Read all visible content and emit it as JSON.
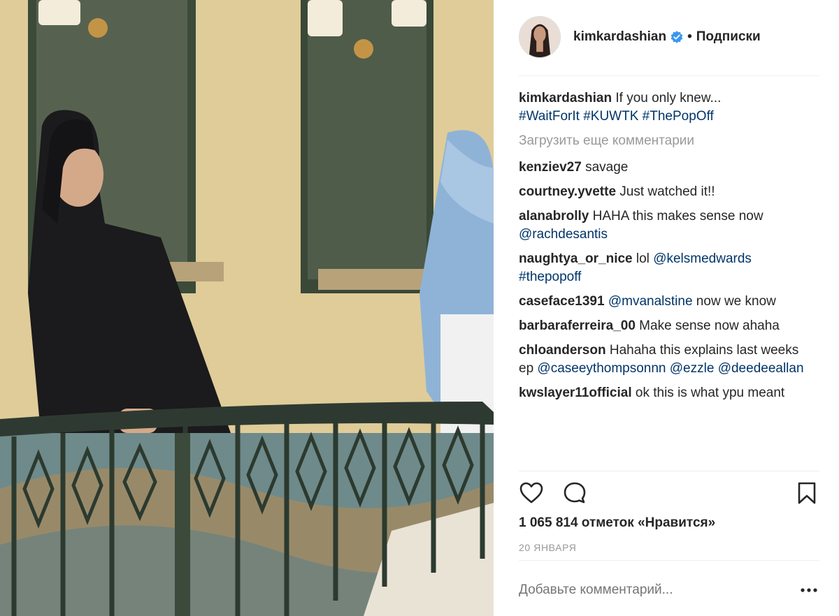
{
  "post": {
    "username": "kimkardashian",
    "separator": "•",
    "follow_label": "Подписки",
    "caption_user": "kimkardashian",
    "caption_text": " If you only knew...",
    "caption_tags": [
      "#WaitForIt",
      "#KUWTK",
      "#ThePopOff"
    ],
    "load_more": "Загрузить еще комментарии",
    "likes": "1 065 814 отметок «Нравится»",
    "date": "20 ЯНВАРЯ",
    "comment_placeholder": "Добавьте комментарий...",
    "more_options": "•••"
  },
  "comments": [
    {
      "user": "kenziev27",
      "parts": [
        {
          "t": " savage"
        }
      ]
    },
    {
      "user": "courtney.yvette",
      "parts": [
        {
          "t": " Just watched it!!"
        }
      ]
    },
    {
      "user": "alanabrolly",
      "parts": [
        {
          "t": " HAHA this makes sense now "
        },
        {
          "tag": "@rachdesantis"
        }
      ]
    },
    {
      "user": "naughtya_or_nice",
      "parts": [
        {
          "t": " lol "
        },
        {
          "tag": "@kelsmedwards"
        },
        {
          "t": " "
        },
        {
          "tag": "#thepopoff"
        }
      ]
    },
    {
      "user": "caseface1391",
      "parts": [
        {
          "t": " "
        },
        {
          "tag": "@mvanalstine"
        },
        {
          "t": " now we know"
        }
      ]
    },
    {
      "user": "barbaraferreira_00",
      "parts": [
        {
          "t": " Make sense now ahaha"
        }
      ]
    },
    {
      "user": "chloanderson",
      "parts": [
        {
          "t": " Hahaha this explains last weeks ep "
        },
        {
          "tag": "@caseeythompsonnn"
        },
        {
          "t": " "
        },
        {
          "tag": "@ezzle"
        },
        {
          "t": " "
        },
        {
          "tag": "@deedeeallan"
        }
      ]
    },
    {
      "user": "kwslayer11official",
      "parts": [
        {
          "t": " ok this is what ypu meant"
        }
      ]
    }
  ],
  "icons": {
    "like": "heart-icon",
    "comment": "comment-icon",
    "save": "bookmark-icon",
    "verified": "verified-badge-icon"
  },
  "colors": {
    "link": "#003569",
    "muted": "#999999",
    "verified": "#3897f0",
    "text": "#262626"
  }
}
